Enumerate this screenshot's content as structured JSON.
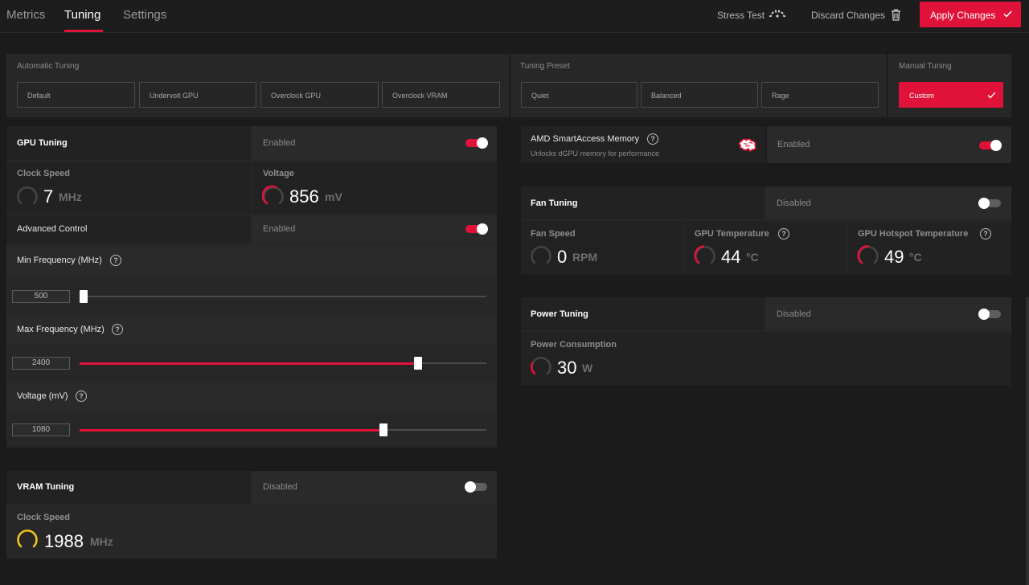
{
  "nav": {
    "tabs": [
      {
        "label": "Metrics"
      },
      {
        "label": "Tuning"
      },
      {
        "label": "Settings"
      }
    ],
    "stress_test_label": "Stress Test",
    "discard_label": "Discard Changes",
    "apply_label": "Apply Changes"
  },
  "presets": {
    "automatic_title": "Automatic Tuning",
    "automatic_options": [
      "Default",
      "Undervolt GPU",
      "Overclock GPU",
      "Overclock VRAM"
    ],
    "tuning_preset_title": "Tuning Preset",
    "tuning_preset_options": [
      "Quiet",
      "Balanced",
      "Rage"
    ],
    "manual_title": "Manual Tuning",
    "manual_option": "Custom"
  },
  "gpu_tuning": {
    "title": "GPU Tuning",
    "status": "Enabled",
    "enabled": true,
    "clock_speed": {
      "label": "Clock Speed",
      "value": "7",
      "unit": "MHz"
    },
    "voltage": {
      "label": "Voltage",
      "value": "856",
      "unit": "mV"
    },
    "advanced_control": {
      "label": "Advanced Control",
      "status": "Enabled",
      "enabled": true
    },
    "min_frequency": {
      "label": "Min Frequency (MHz)",
      "value": "500",
      "fraction": 0.0
    },
    "max_frequency": {
      "label": "Max Frequency (MHz)",
      "value": "2400",
      "fraction": 0.822
    },
    "voltage_slider": {
      "label": "Voltage (mV)",
      "value": "1080",
      "fraction": 0.737
    }
  },
  "vram_tuning": {
    "title": "VRAM Tuning",
    "status": "Disabled",
    "enabled": false,
    "clock_speed": {
      "label": "Clock Speed",
      "value": "1988",
      "unit": "MHz"
    }
  },
  "smart_access": {
    "title": "AMD SmartAccess Memory",
    "subtitle": "Unlocks dGPU memory for performance",
    "status": "Enabled",
    "enabled": true
  },
  "fan_tuning": {
    "title": "Fan Tuning",
    "status": "Disabled",
    "enabled": false,
    "fan_speed": {
      "label": "Fan Speed",
      "value": "0",
      "unit": "RPM"
    },
    "gpu_temp": {
      "label": "GPU Temperature",
      "value": "44",
      "unit": "°C"
    },
    "hotspot_temp": {
      "label": "GPU Hotspot Temperature",
      "value": "49",
      "unit": "°C"
    }
  },
  "power_tuning": {
    "title": "Power Tuning",
    "status": "Disabled",
    "enabled": false,
    "power": {
      "label": "Power Consumption",
      "value": "30",
      "unit": "W"
    }
  },
  "colors": {
    "accent": "#e1123a",
    "gauge_idle": "#444444",
    "gauge_vram": "#f2c21b"
  }
}
